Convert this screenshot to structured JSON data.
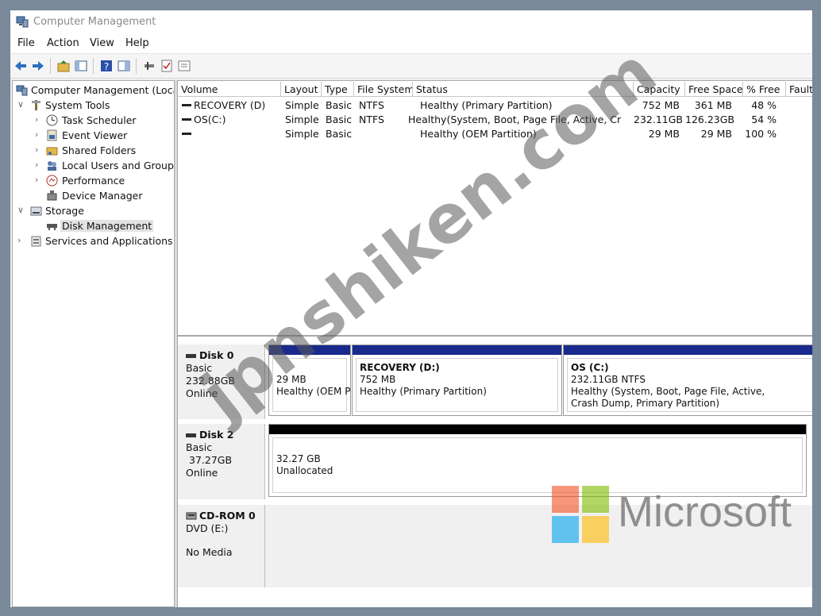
{
  "window": {
    "title": "Computer Management"
  },
  "menu": [
    "File",
    "Action",
    "View",
    "Help"
  ],
  "tree": {
    "root": "Computer Management (Local",
    "items": [
      {
        "label": "System Tools"
      },
      {
        "label": "Task Scheduler"
      },
      {
        "label": "Event Viewer"
      },
      {
        "label": "Shared Folders"
      },
      {
        "label": "Local Users and Groups"
      },
      {
        "label": "Performance"
      },
      {
        "label": "Device Manager"
      },
      {
        "label": "Storage"
      },
      {
        "label": "Disk Management"
      },
      {
        "label": "Services and Applications"
      }
    ]
  },
  "volume_table": {
    "columns": [
      "Volume",
      "Layout",
      "Type",
      "File System",
      "Status",
      "Capacity",
      "Free Space",
      "% Free",
      "Fault"
    ],
    "rows": [
      {
        "volume": "RECOVERY (D)",
        "layout": "Simple",
        "type": "Basic",
        "fs": "NTFS",
        "status": "Healthy (Primary Partition)",
        "capacity": "752 MB",
        "free": "361 MB",
        "pct": "48 %"
      },
      {
        "volume": "OS(C:)",
        "layout": "Simple",
        "type": "Basic",
        "fs": "NTFS",
        "status": "Healthy(System, Boot, Page File, Active, Cr",
        "capacity": "232.11GB",
        "free": "126.23GB",
        "pct": "54 %"
      },
      {
        "volume": "",
        "layout": "Simple",
        "type": "Basic",
        "fs": "",
        "status": "Healthy (OEM Partition)",
        "capacity": "29 MB",
        "free": "29 MB",
        "pct": "100 %"
      }
    ]
  },
  "disks": {
    "disk0": {
      "name": "Disk 0",
      "kind": "Basic",
      "size": "232.88GB",
      "state": "Online",
      "partitions": [
        {
          "size": "29 MB",
          "status": "Healthy (OEM P"
        },
        {
          "name": "RECOVERY (D:)",
          "size": "752 MB",
          "status": "Healthy (Primary Partition)"
        },
        {
          "name": "OS (C:)",
          "size": "232.11GB NTFS",
          "status1": "Healthy (System, Boot, Page File, Active,",
          "status2": "Crash Dump, Primary Partition)"
        }
      ]
    },
    "disk2": {
      "name": "Disk 2",
      "kind": "Basic",
      "size": "37.27GB",
      "state": "Online",
      "partitions": [
        {
          "size": "32.27 GB",
          "status": "Unallocated"
        }
      ]
    },
    "cdrom0": {
      "name": "CD-ROM 0",
      "kind": "DVD (E:)",
      "state": "No Media"
    }
  },
  "watermark": "jpnshiken.com",
  "brand": {
    "text": "Microsoft",
    "colors": [
      "#f25022",
      "#7fba00",
      "#00a4ef",
      "#ffb900"
    ]
  },
  "colors": {
    "primary_partition_bar": "#1a2a8c",
    "unallocated_bar": "#000000"
  }
}
